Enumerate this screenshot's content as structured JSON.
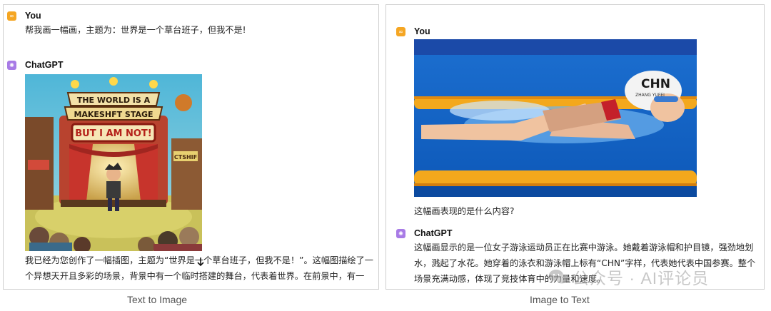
{
  "left_panel": {
    "user": {
      "name": "You",
      "message": "帮我画一幅画，主题为：世界是一个草台班子，但我不是!"
    },
    "assistant": {
      "name": "ChatGPT",
      "image_sign_lines": [
        "THE WORLD IS A",
        "MAKESHFT STAGE",
        "BUT I AM NOT!"
      ],
      "side_sign": "CTSHIF",
      "message": "我已经为您创作了一幅插图，主题为“世界是一个草台班子，但我不是！”。这幅图描绘了一个异想天开且多彩的场景，背景中有一个临时搭建的舞台，代表着世界。在前景中，有一"
    },
    "caption": "Text to Image"
  },
  "right_panel": {
    "user": {
      "name": "You",
      "message": "这幅画表现的是什么内容?"
    },
    "photo": {
      "cap_text": "CHN",
      "cap_subtext": "ZHANG YUFEI"
    },
    "assistant": {
      "name": "ChatGPT",
      "message": "这幅画显示的是一位女子游泳运动员正在比赛中游泳。她戴着游泳帽和护目镜，强劲地划水，溅起了水花。她穿着的泳衣和游泳帽上标有“CHN”字样，代表她代表中国参赛。整个场景充满动感，体现了竞技体育中的力量和速度。"
    },
    "caption": "Image to Text"
  },
  "watermark": "公众号 · AI评论员",
  "colors": {
    "user_avatar": "#f5a623",
    "assistant_avatar": "#a87be6",
    "border": "#cfcfcf"
  },
  "icons": {
    "user_avatar": "infinity-icon",
    "assistant_avatar": "gear-icon",
    "scroll": "arrow-down-icon",
    "watermark": "wechat-icon"
  }
}
